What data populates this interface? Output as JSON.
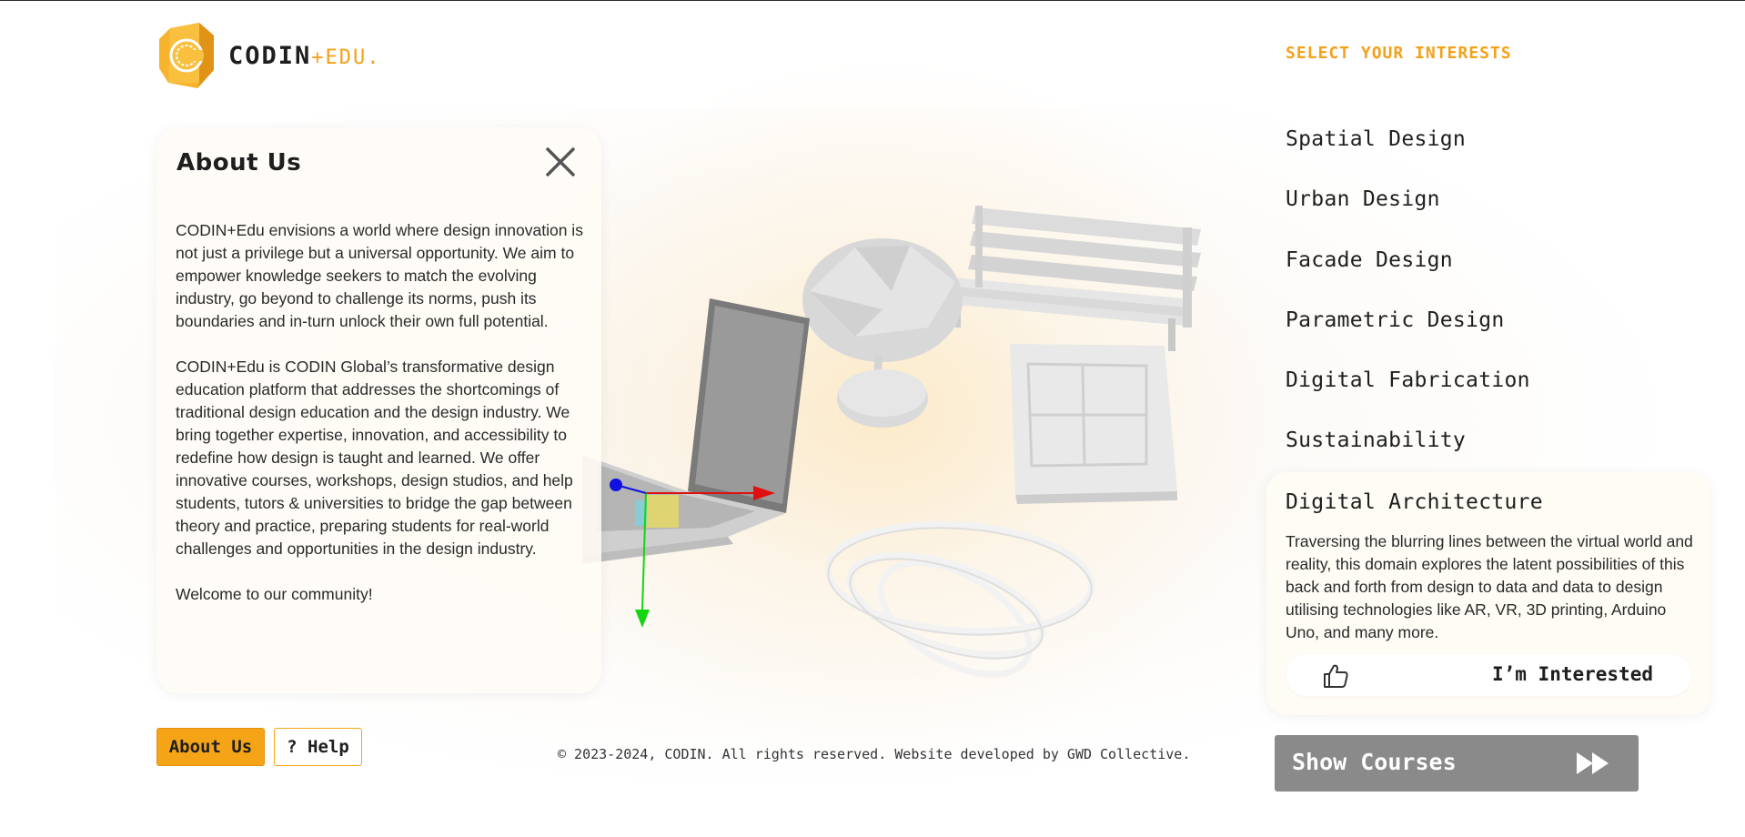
{
  "logo": {
    "text_main": "CODIN",
    "text_accent": "+EDU.",
    "accent_color": "#f4a11a",
    "icon": "codin-logo-icon"
  },
  "about_panel": {
    "title": "About Us",
    "close_icon": "close-icon",
    "paragraphs": [
      "CODIN+Edu envisions a world where design innovation is not just a privilege but a universal opportunity. We aim to empower knowledge seekers to match the evolving industry, go beyond to challenge its norms, push its boundaries and in-turn unlock their own full potential.",
      "CODIN+Edu is CODIN Global’s transformative design education platform that addresses the shortcomings of traditional design education and the design industry. We bring together expertise, innovation, and accessibility to redefine how design is taught and learned. We offer innovative courses, workshops, design studios, and help students, tutors & universities to bridge the gap between theory and practice, preparing students for real-world challenges and opportunities in the design industry.",
      "Welcome to our community!"
    ]
  },
  "bottom_buttons": {
    "about": "About Us",
    "help": "? Help"
  },
  "footer": "© 2023-2024, CODIN. All rights reserved. Website developed by GWD Collective.",
  "interests": {
    "heading": "SELECT YOUR INTERESTS",
    "items": [
      "Spatial Design",
      "Urban Design",
      "Facade Design",
      "Parametric Design",
      "Digital Fabrication",
      "Sustainability"
    ],
    "selected": {
      "title": "Digital Architecture",
      "description": "Traversing the blurring lines between the virtual world and reality, this domain explores the latent possibilities of this back and forth from design to data and data to design utilising technologies like AR, VR, 3D printing, Arduino Uno, and many more.",
      "button_label": "I’m Interested",
      "button_icon": "thumbs-up-icon"
    }
  },
  "show_courses": {
    "label": "Show Courses",
    "icon": "fast-forward-icon"
  },
  "colors": {
    "accent": "#f5a417",
    "button_gray": "#8a8a8a",
    "axis_x": "#e01010",
    "axis_y": "#12d612",
    "axis_z": "#1010e0"
  }
}
